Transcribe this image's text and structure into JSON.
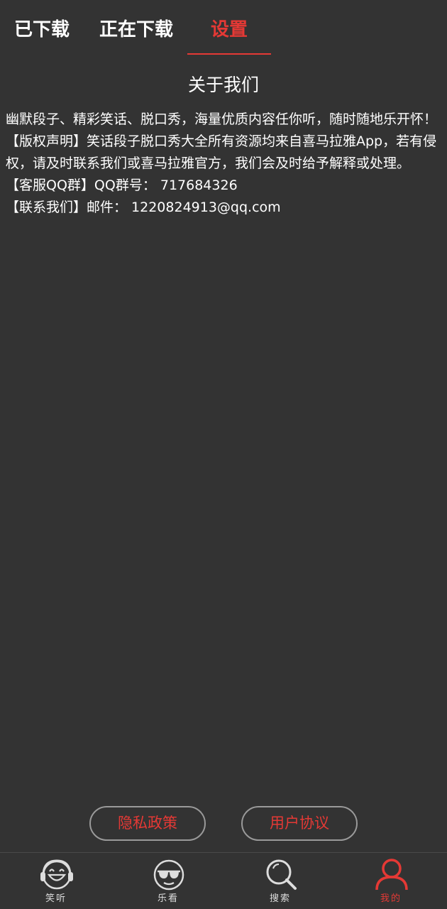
{
  "tabs": [
    {
      "label": "已下载"
    },
    {
      "label": "正在下载"
    },
    {
      "label": "设置",
      "active": true
    }
  ],
  "about": {
    "title": "关于我们",
    "lines": [
      "幽默段子、精彩笑话、脱口秀，海量优质内容任你听，随时随地乐开怀！",
      "【版权声明】笑话段子脱口秀大全所有资源均来自喜马拉雅App，若有侵权，请及时联系我们或喜马拉雅官方，我们会及时给予解释或处理。",
      "【客服QQ群】QQ群号： 717684326",
      "【联系我们】邮件： 1220824913@qq.com"
    ]
  },
  "buttons": {
    "privacy": "隐私政策",
    "agreement": "用户协议"
  },
  "nav": [
    {
      "label": "笑听",
      "icon": "laughing-headphones-icon"
    },
    {
      "label": "乐看",
      "icon": "sunglasses-face-icon"
    },
    {
      "label": "搜索",
      "icon": "search-icon"
    },
    {
      "label": "我的",
      "icon": "user-icon",
      "active": true
    }
  ],
  "colors": {
    "background": "#333333",
    "accent": "#e53935",
    "text": "#ffffff"
  }
}
